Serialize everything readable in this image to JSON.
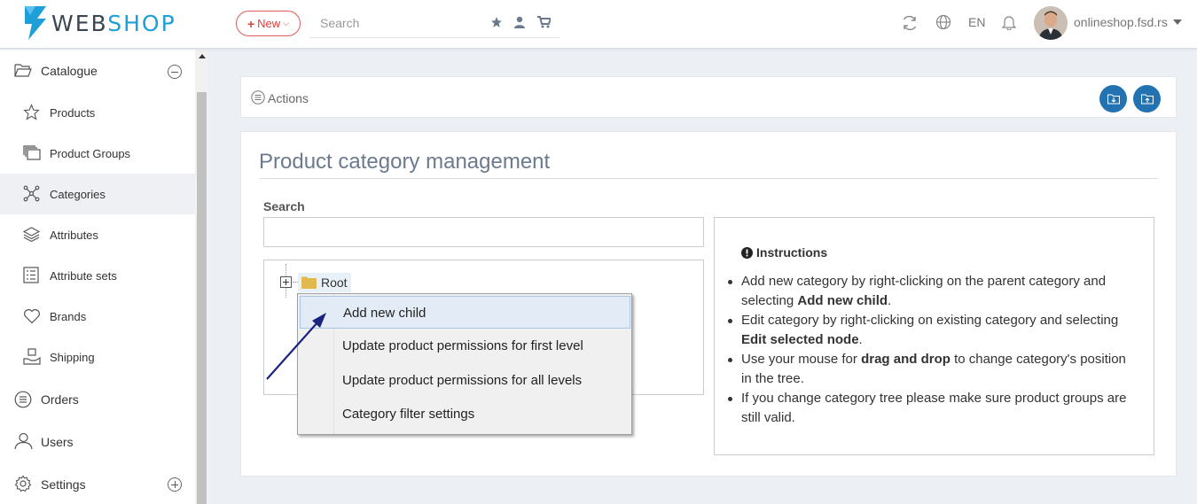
{
  "header": {
    "logo_prefix": "WEB",
    "logo_suffix": "SHOP",
    "new_label": "New",
    "search_placeholder": "Search",
    "language": "EN",
    "account_name": "onlineshop.fsd.rs"
  },
  "sidebar": {
    "catalogue": "Catalogue",
    "items": [
      "Products",
      "Product Groups",
      "Categories",
      "Attributes",
      "Attribute sets",
      "Brands",
      "Shipping"
    ],
    "active_item": "Categories",
    "orders": "Orders",
    "users": "Users",
    "settings": "Settings"
  },
  "actions": {
    "label": "Actions"
  },
  "main": {
    "title": "Product category management",
    "search_label": "Search",
    "root_label": "Root"
  },
  "context_menu": {
    "items": [
      "Add new child",
      "Update product permissions for first level",
      "Update product permissions for all levels",
      "Category filter settings"
    ],
    "highlighted": "Add new child"
  },
  "instructions": {
    "title": "Instructions",
    "items": [
      {
        "pre": "Add new category by right-clicking on the parent category and selecting ",
        "bold": "Add new child",
        "post": "."
      },
      {
        "pre": "Edit category by right-clicking on existing category and selecting ",
        "bold": "Edit selected node",
        "post": "."
      },
      {
        "pre": "Use your mouse for ",
        "bold": "drag and drop",
        "post": " to change category's position in the tree."
      },
      {
        "pre": "If you change category tree please make sure product groups are still valid.",
        "bold": "",
        "post": ""
      }
    ]
  },
  "colors": {
    "accent": "#2373b3",
    "logo_blue": "#1e9fd8",
    "new_red": "#d9403e",
    "title": "#6b7a8f",
    "annotation_arrow": "#1a237e"
  }
}
